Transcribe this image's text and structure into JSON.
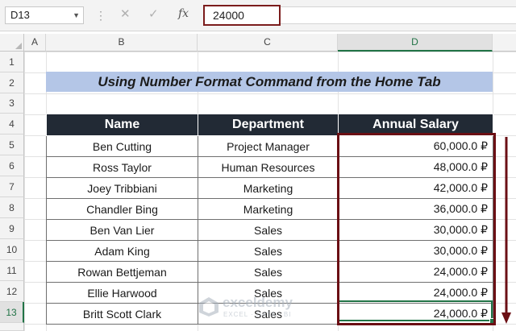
{
  "formula_bar": {
    "name_box": "D13",
    "cancel_symbol": "✕",
    "enter_symbol": "✓",
    "fx_label": "fx",
    "formula_value": "24000"
  },
  "columns": [
    "A",
    "B",
    "C",
    "D"
  ],
  "active_column": "D",
  "rows": [
    "1",
    "2",
    "3",
    "4",
    "5",
    "6",
    "7",
    "8",
    "9",
    "10",
    "11",
    "12",
    "13"
  ],
  "active_row": "13",
  "sheet": {
    "title": "Using Number Format Command from the Home Tab",
    "headers": [
      "Name",
      "Department",
      "Annual Salary"
    ],
    "records": [
      {
        "name": "Ben Cutting",
        "department": "Project Manager",
        "salary": "60,000.0 ₽"
      },
      {
        "name": "Ross Taylor",
        "department": "Human Resources",
        "salary": "48,000.0 ₽"
      },
      {
        "name": "Joey Tribbiani",
        "department": "Marketing",
        "salary": "42,000.0 ₽"
      },
      {
        "name": "Chandler Bing",
        "department": "Marketing",
        "salary": "36,000.0 ₽"
      },
      {
        "name": "Ben Van Lier",
        "department": "Sales",
        "salary": "30,000.0 ₽"
      },
      {
        "name": "Adam King",
        "department": "Sales",
        "salary": "30,000.0 ₽"
      },
      {
        "name": "Rowan Bettjeman",
        "department": "Sales",
        "salary": "24,000.0 ₽"
      },
      {
        "name": "Ellie Harwood",
        "department": "Sales",
        "salary": "24,000.0 ₽"
      },
      {
        "name": "Britt Scott Clark",
        "department": "Sales",
        "salary": "24,000.0 ₽"
      }
    ]
  },
  "watermark": {
    "name": "exceldemy",
    "tagline": "EXCEL · DATA · BI"
  },
  "colors": {
    "accent": "#217346",
    "highlight_border": "#6b0f14",
    "header_fill": "#222a35",
    "title_fill": "#b4c6e7"
  }
}
